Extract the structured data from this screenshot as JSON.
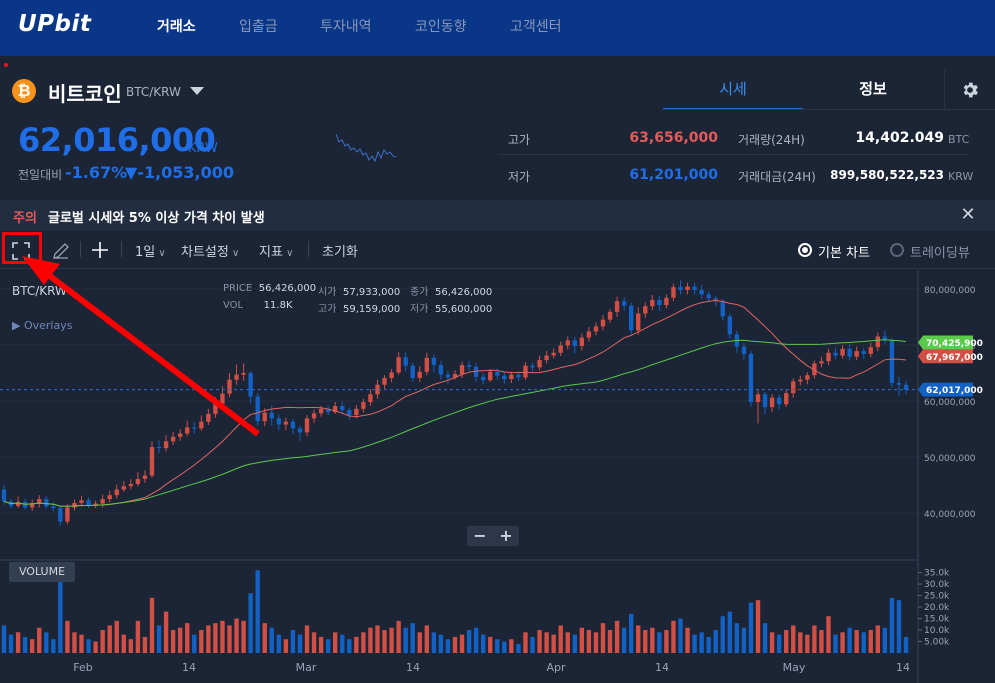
{
  "nav": {
    "logo": "UPbit",
    "items": [
      "거래소",
      "입출금",
      "투자내역",
      "코인동향",
      "고객센터"
    ]
  },
  "coin": {
    "name": "비트코인",
    "pair": "BTC/KRW",
    "icon": "bitcoin-icon",
    "tabs": {
      "quote": "시세",
      "info": "정보"
    }
  },
  "price": {
    "current": "62,016,000",
    "unit": "KRW",
    "change_label": "전일대비",
    "change_rate": "-1.67%",
    "change_amount": "▼-1,053,000"
  },
  "stats": {
    "high_label": "고가",
    "high": "63,656,000",
    "low_label": "저가",
    "low": "61,201,000",
    "vol_label": "거래량(24H)",
    "vol": "14,402.049",
    "vol_unit": "BTC",
    "amt_label": "거래대금(24H)",
    "amt": "899,580,522,523",
    "amt_unit": "KRW"
  },
  "notice": {
    "tag": "주의",
    "text": "글로벌 시세와 5% 이상 가격 차이 발생"
  },
  "toolbar": {
    "interval": "1일",
    "chart_settings": "차트설정",
    "indicators": "지표",
    "reset": "초기화",
    "basic_chart": "기본 차트",
    "tradingview": "트레이딩뷰"
  },
  "legend": {
    "symbol": "BTC/KRW",
    "overlays": "Overlays",
    "price_label": "PRICE",
    "price": "56,426,000",
    "vol_label": "VOL",
    "vol": "11.8K",
    "open_label": "시가",
    "open": "57,933,000",
    "high_label": "고가",
    "high": "59,159,000",
    "close_label": "종가",
    "close": "56,426,000",
    "low_label": "저가",
    "low": "55,600,000"
  },
  "volume_label": "VOLUME",
  "colors": {
    "header": "#093687",
    "up": "#d24f45",
    "down": "#1261c4",
    "ma_short": "#e06560",
    "ma_long": "#5bc94a"
  },
  "chart_data": {
    "type": "candlestick",
    "y_ticks": [
      "80,000,000",
      "70,000,000",
      "60,000,000",
      "50,000,000",
      "40,000,000"
    ],
    "ylim": [
      32000000,
      83000000
    ],
    "x_ticks": [
      "Feb",
      "14",
      "Mar",
      "14",
      "Apr",
      "14",
      "May",
      "14"
    ],
    "price_tags": [
      {
        "label": "70,425,900",
        "value": 70425900,
        "color": "#5bc94a"
      },
      {
        "label": "67,967,000",
        "value": 67967000,
        "color": "#d24f45"
      },
      {
        "label": "62,017,000",
        "value": 62017000,
        "color": "#1261c4"
      }
    ],
    "volume_ticks": [
      "35.0k",
      "30.0k",
      "25.0k",
      "20.0k",
      "15.0k",
      "10.0k",
      "5.00k"
    ],
    "candles": [
      [
        44200000,
        42100000,
        45000000,
        41500000,
        12
      ],
      [
        42100000,
        41300000,
        42500000,
        40800000,
        8
      ],
      [
        41300000,
        42000000,
        43000000,
        40900000,
        9
      ],
      [
        42000000,
        41000000,
        42600000,
        40600000,
        7
      ],
      [
        41000000,
        41800000,
        42400000,
        40400000,
        6
      ],
      [
        41800000,
        42500000,
        43200000,
        41000000,
        11
      ],
      [
        42500000,
        41200000,
        43000000,
        40800000,
        9
      ],
      [
        41200000,
        40900000,
        41900000,
        40300000,
        6
      ],
      [
        40900000,
        38500000,
        41300000,
        37800000,
        34
      ],
      [
        38500000,
        41000000,
        41600000,
        38000000,
        14
      ],
      [
        41000000,
        41800000,
        42400000,
        40500000,
        9
      ],
      [
        41800000,
        42300000,
        43100000,
        41200000,
        8
      ],
      [
        42300000,
        41400000,
        42800000,
        40900000,
        6
      ],
      [
        41400000,
        41700000,
        42200000,
        40900000,
        5
      ],
      [
        41700000,
        42500000,
        43300000,
        41000000,
        10
      ],
      [
        42500000,
        43200000,
        44000000,
        41900000,
        12
      ],
      [
        43200000,
        44200000,
        45100000,
        42600000,
        14
      ],
      [
        44200000,
        44800000,
        45700000,
        43800000,
        8
      ],
      [
        44800000,
        45200000,
        46100000,
        44200000,
        6
      ],
      [
        45200000,
        46100000,
        47300000,
        44800000,
        14
      ],
      [
        46100000,
        46700000,
        47600000,
        45400000,
        7
      ],
      [
        46700000,
        51800000,
        52800000,
        46300000,
        24
      ],
      [
        51800000,
        51600000,
        53000000,
        50700000,
        12
      ],
      [
        51600000,
        52800000,
        53900000,
        51000000,
        18
      ],
      [
        52800000,
        53600000,
        54500000,
        52200000,
        10
      ],
      [
        53600000,
        54200000,
        55000000,
        52900000,
        11
      ],
      [
        54200000,
        55300000,
        56500000,
        53700000,
        13
      ],
      [
        55300000,
        55100000,
        56200000,
        54200000,
        8
      ],
      [
        55100000,
        56300000,
        57400000,
        54700000,
        10
      ],
      [
        56300000,
        57700000,
        58600000,
        55700000,
        12
      ],
      [
        57700000,
        59500000,
        60700000,
        57000000,
        13
      ],
      [
        59500000,
        61300000,
        62600000,
        58600000,
        14
      ],
      [
        61300000,
        63800000,
        65000000,
        60700000,
        12
      ],
      [
        63800000,
        64700000,
        66500000,
        62900000,
        15
      ],
      [
        64700000,
        65000000,
        66700000,
        63600000,
        14
      ],
      [
        65000000,
        60800000,
        65300000,
        59500000,
        26
      ],
      [
        60800000,
        56400000,
        61400000,
        55600000,
        36
      ],
      [
        56400000,
        57900000,
        58700000,
        55500000,
        13
      ],
      [
        57900000,
        56900000,
        59200000,
        55600000,
        11
      ],
      [
        56900000,
        55800000,
        57600000,
        54800000,
        8
      ],
      [
        55800000,
        56300000,
        57000000,
        54800000,
        6
      ],
      [
        56300000,
        55100000,
        56800000,
        54100000,
        10
      ],
      [
        55100000,
        54400000,
        55600000,
        52900000,
        8
      ],
      [
        54400000,
        56900000,
        57500000,
        53700000,
        12
      ],
      [
        56900000,
        57800000,
        58500000,
        56100000,
        9
      ],
      [
        57800000,
        58600000,
        59100000,
        57200000,
        7
      ],
      [
        58600000,
        58000000,
        59200000,
        57500000,
        6
      ],
      [
        58000000,
        59100000,
        59800000,
        57700000,
        9
      ],
      [
        59100000,
        58400000,
        59900000,
        57600000,
        8
      ],
      [
        58400000,
        57500000,
        58800000,
        56700000,
        6
      ],
      [
        57500000,
        58600000,
        59300000,
        56900000,
        7
      ],
      [
        58600000,
        59800000,
        60400000,
        57900000,
        9
      ],
      [
        59800000,
        61200000,
        62100000,
        59100000,
        11
      ],
      [
        61200000,
        62900000,
        63800000,
        60400000,
        12
      ],
      [
        62900000,
        64100000,
        64600000,
        62100000,
        10
      ],
      [
        64100000,
        65100000,
        65700000,
        63300000,
        11
      ],
      [
        65100000,
        67800000,
        68700000,
        64700000,
        14
      ],
      [
        67800000,
        66300000,
        68700000,
        65300000,
        11
      ],
      [
        66300000,
        64100000,
        66900000,
        63500000,
        13
      ],
      [
        64100000,
        65200000,
        66200000,
        63400000,
        9
      ],
      [
        65200000,
        67700000,
        68600000,
        64600000,
        12
      ],
      [
        67700000,
        66400000,
        68300000,
        65100000,
        9
      ],
      [
        66400000,
        64700000,
        67100000,
        63800000,
        8
      ],
      [
        64700000,
        64200000,
        65300000,
        63100000,
        6
      ],
      [
        64200000,
        64800000,
        65500000,
        63800000,
        7
      ],
      [
        64800000,
        66400000,
        67000000,
        64100000,
        8
      ],
      [
        66400000,
        66100000,
        67200000,
        65400000,
        10
      ],
      [
        66100000,
        64300000,
        66800000,
        63500000,
        11
      ],
      [
        64300000,
        63700000,
        64900000,
        63000000,
        8
      ],
      [
        63700000,
        65200000,
        65700000,
        63400000,
        7
      ],
      [
        65200000,
        64500000,
        65800000,
        63800000,
        6
      ],
      [
        64500000,
        63900000,
        65100000,
        63100000,
        5
      ],
      [
        63900000,
        64700000,
        65200000,
        63200000,
        6
      ],
      [
        64700000,
        64200000,
        65300000,
        63600000,
        4
      ],
      [
        64200000,
        66300000,
        66900000,
        63800000,
        9
      ],
      [
        66300000,
        66000000,
        66800000,
        65200000,
        7
      ],
      [
        66000000,
        67300000,
        68100000,
        65400000,
        10
      ],
      [
        67300000,
        68100000,
        68900000,
        66700000,
        9
      ],
      [
        68100000,
        68600000,
        69400000,
        67600000,
        8
      ],
      [
        68600000,
        69900000,
        70600000,
        68000000,
        12
      ],
      [
        69900000,
        70800000,
        71500000,
        69200000,
        9
      ],
      [
        70800000,
        69800000,
        71400000,
        68500000,
        8
      ],
      [
        69800000,
        71300000,
        72000000,
        69000000,
        11
      ],
      [
        71300000,
        72400000,
        73200000,
        70600000,
        10
      ],
      [
        72400000,
        73300000,
        74000000,
        71700000,
        9
      ],
      [
        73300000,
        74500000,
        75300000,
        72600000,
        13
      ],
      [
        74500000,
        75900000,
        76400000,
        73900000,
        10
      ],
      [
        75900000,
        77800000,
        78600000,
        75000000,
        14
      ],
      [
        77800000,
        77000000,
        78500000,
        76100000,
        11
      ],
      [
        77000000,
        72600000,
        77500000,
        71900000,
        17
      ],
      [
        72600000,
        75600000,
        76700000,
        71800000,
        12
      ],
      [
        75600000,
        76900000,
        77600000,
        74800000,
        10
      ],
      [
        76900000,
        78000000,
        78900000,
        76200000,
        11
      ],
      [
        78000000,
        77100000,
        78700000,
        76100000,
        9
      ],
      [
        77100000,
        78400000,
        79000000,
        76500000,
        10
      ],
      [
        78400000,
        80300000,
        80900000,
        77800000,
        14
      ],
      [
        80300000,
        79800000,
        81500000,
        79000000,
        15
      ],
      [
        79800000,
        80400000,
        81100000,
        79000000,
        11
      ],
      [
        80400000,
        79800000,
        81000000,
        79000000,
        8
      ],
      [
        79800000,
        79000000,
        80700000,
        78200000,
        9
      ],
      [
        79000000,
        78300000,
        79600000,
        77600000,
        7
      ],
      [
        78300000,
        77800000,
        78800000,
        76900000,
        10
      ],
      [
        77800000,
        75100000,
        78200000,
        74400000,
        16
      ],
      [
        75100000,
        71900000,
        75600000,
        71100000,
        18
      ],
      [
        71900000,
        69700000,
        72500000,
        68600000,
        13
      ],
      [
        69700000,
        68400000,
        70400000,
        67400000,
        11
      ],
      [
        68400000,
        59800000,
        68900000,
        59000000,
        22
      ],
      [
        59800000,
        61200000,
        61900000,
        56000000,
        23
      ],
      [
        61200000,
        58900000,
        61600000,
        57600000,
        13
      ],
      [
        58900000,
        60600000,
        61200000,
        58000000,
        9
      ],
      [
        60600000,
        59400000,
        61200000,
        58500000,
        8
      ],
      [
        59400000,
        61400000,
        62100000,
        58900000,
        10
      ],
      [
        61400000,
        63500000,
        64000000,
        60600000,
        12
      ],
      [
        63500000,
        63800000,
        64500000,
        62800000,
        9
      ],
      [
        63800000,
        64600000,
        65100000,
        63000000,
        8
      ],
      [
        64600000,
        66700000,
        67200000,
        64000000,
        12
      ],
      [
        66700000,
        67100000,
        67900000,
        66000000,
        10
      ],
      [
        67100000,
        68600000,
        69300000,
        66400000,
        16
      ],
      [
        68600000,
        68100000,
        69500000,
        67500000,
        8
      ],
      [
        68100000,
        69300000,
        69900000,
        67600000,
        9
      ],
      [
        69300000,
        67900000,
        70100000,
        67200000,
        11
      ],
      [
        67900000,
        68900000,
        69700000,
        67300000,
        10
      ],
      [
        68900000,
        68400000,
        69500000,
        67500000,
        9
      ],
      [
        68400000,
        69600000,
        70400000,
        67800000,
        10
      ],
      [
        69600000,
        71500000,
        72200000,
        68900000,
        12
      ],
      [
        71500000,
        70800000,
        72500000,
        70100000,
        11
      ],
      [
        70800000,
        63200000,
        71200000,
        62400000,
        24
      ],
      [
        63200000,
        62900000,
        64300000,
        60900000,
        23
      ],
      [
        62900000,
        62000000,
        63600000,
        61200000,
        7
      ]
    ]
  }
}
